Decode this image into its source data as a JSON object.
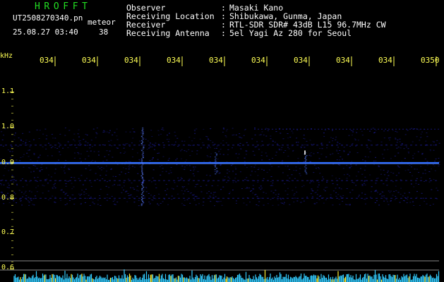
{
  "header": {
    "title": "HROFFT",
    "filename": "UT2508270340.pn",
    "type": "meteor",
    "datetime": "25.08.27 03:40",
    "count": "38"
  },
  "meta": [
    {
      "label": "Observer",
      "colon": ":",
      "value": "Masaki Kano"
    },
    {
      "label": "Receiving Location",
      "colon": ":",
      "value": "Shibukawa, Gunma, Japan"
    },
    {
      "label": "Receiver",
      "colon": ":",
      "value": "RTL-SDR SDR# 43dB L15 96.7MHz CW"
    },
    {
      "label": "Receiving Antenna",
      "colon": ":",
      "value": "5el Yagi Az 280 for Seoul"
    }
  ],
  "chart_data": {
    "type": "heatmap",
    "ylabel": "kHz",
    "y_ticks": [
      "1.1",
      "1.0",
      "0.9",
      "0.8",
      "0.7",
      "0.6"
    ],
    "ylim": [
      0.6,
      1.1
    ],
    "x_ticks": [
      "034",
      "034",
      "034",
      "034",
      "034",
      "034",
      "034",
      "034",
      "034",
      "0350"
    ],
    "carrier_khz": 0.9,
    "sidebands_khz": [
      0.95,
      0.85,
      0.8
    ],
    "meteor_events_x_tick_index": [
      3
    ]
  },
  "colors": {
    "title": "#22dd22",
    "text": "#ffffff",
    "axis_text": "#ffff55",
    "carrier": "#2f6bff",
    "noise": "#1a1a8c",
    "spectrum": "#33ccff",
    "spectrum_peak": "#ffee33",
    "baseline": "#888888"
  }
}
